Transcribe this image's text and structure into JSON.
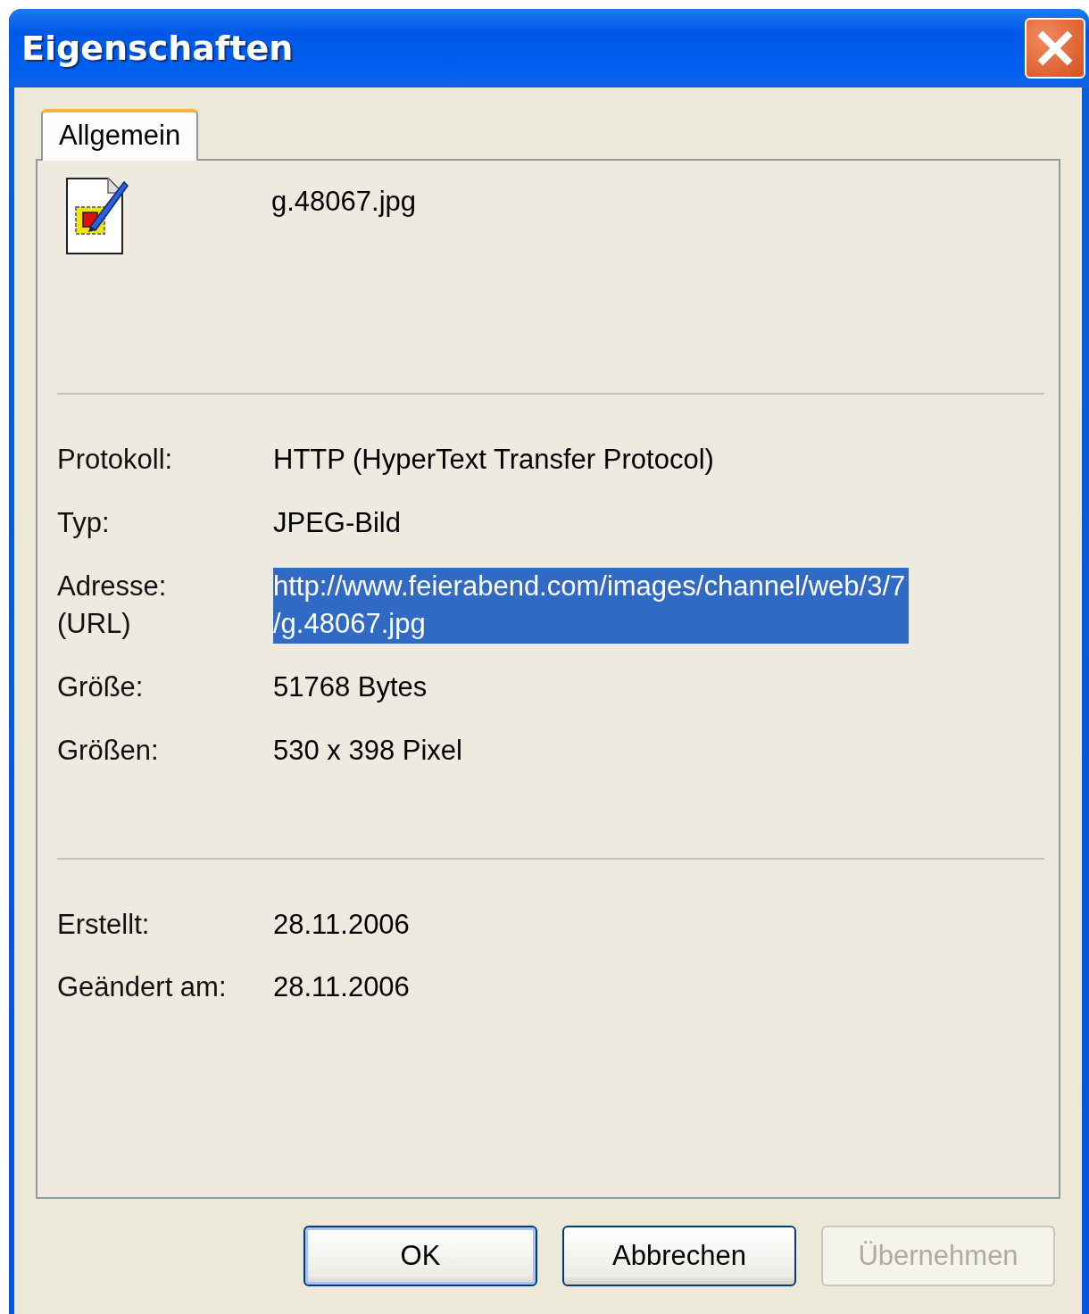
{
  "window": {
    "title": "Eigenschaften"
  },
  "tabs": [
    {
      "label": "Allgemein",
      "selected": true
    }
  ],
  "file": {
    "name": "g.48067.jpg"
  },
  "sections": [
    {
      "rows": [
        {
          "label": "Protokoll:",
          "value": "HTTP (HyperText Transfer Protocol)",
          "selected": false
        },
        {
          "label": "Typ:",
          "value": "JPEG-Bild",
          "selected": false
        },
        {
          "label": "Adresse:\n(URL)",
          "value": "http://www.feierabend.com/images/channel/web/3/7/g.48067.jpg",
          "selected": true
        },
        {
          "label": "Größe:",
          "value": "51768 Bytes",
          "selected": false
        },
        {
          "label": "Größen:",
          "value": "530  x  398  Pixel",
          "selected": false
        }
      ]
    },
    {
      "rows": [
        {
          "label": "Erstellt:",
          "value": "28.11.2006",
          "selected": false
        },
        {
          "label": "Geändert am:",
          "value": "28.11.2006",
          "selected": false
        }
      ]
    }
  ],
  "buttons": [
    {
      "label": "OK",
      "default": true,
      "disabled": false
    },
    {
      "label": "Abbrechen",
      "default": false,
      "disabled": false
    },
    {
      "label": "Übernehmen",
      "default": false,
      "disabled": true
    }
  ]
}
